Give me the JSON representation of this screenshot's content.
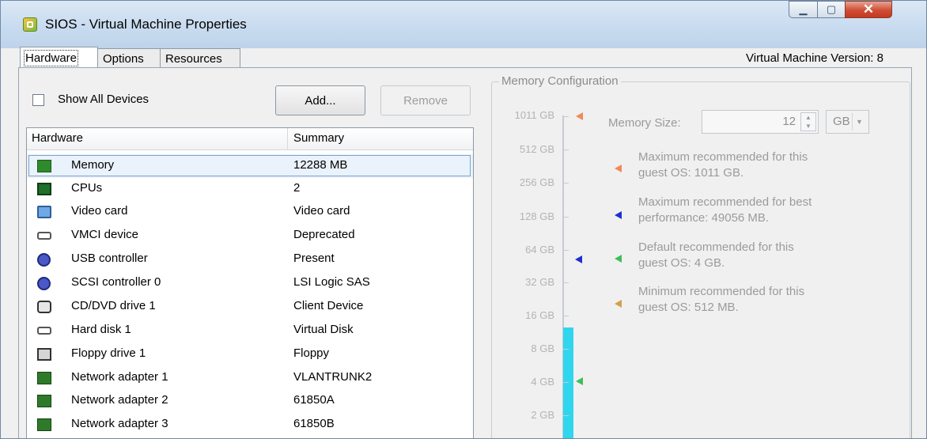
{
  "window": {
    "title": "SIOS - Virtual Machine Properties",
    "version_text": "Virtual Machine Version: 8"
  },
  "tabs": [
    "Hardware",
    "Options",
    "Resources"
  ],
  "toolbar": {
    "show_all_devices": "Show All Devices",
    "show_all_devices_checked": false,
    "add": "Add...",
    "remove": "Remove"
  },
  "hardware_table": {
    "columns": [
      "Hardware",
      "Summary"
    ],
    "rows": [
      {
        "name": "Memory",
        "summary": "12288 MB",
        "icon": "memory-icon",
        "selected": true
      },
      {
        "name": "CPUs",
        "summary": "2",
        "icon": "cpu-icon"
      },
      {
        "name": "Video card",
        "summary": "Video card",
        "icon": "monitor-icon"
      },
      {
        "name": "VMCI device",
        "summary": "Deprecated",
        "icon": "vmci-device-icon"
      },
      {
        "name": "USB controller",
        "summary": "Present",
        "icon": "usb-controller-icon"
      },
      {
        "name": "SCSI controller 0",
        "summary": "LSI Logic SAS",
        "icon": "scsi-controller-icon"
      },
      {
        "name": "CD/DVD drive 1",
        "summary": "Client Device",
        "icon": "cd-drive-icon"
      },
      {
        "name": "Hard disk 1",
        "summary": "Virtual Disk",
        "icon": "hard-disk-icon"
      },
      {
        "name": "Floppy drive 1",
        "summary": "Floppy",
        "icon": "floppy-icon"
      },
      {
        "name": "Network adapter 1",
        "summary": "VLANTRUNK2",
        "icon": "network-adapter-icon"
      },
      {
        "name": "Network adapter 2",
        "summary": "61850A",
        "icon": "network-adapter-icon"
      },
      {
        "name": "Network adapter 3",
        "summary": "61850B",
        "icon": "network-adapter-icon"
      }
    ]
  },
  "memory_config": {
    "legend": "Memory Configuration",
    "scale_labels": [
      "1011 GB",
      "512 GB",
      "256 GB",
      "128 GB",
      "64 GB",
      "32 GB",
      "16 GB",
      "8 GB",
      "4 GB",
      "2 GB"
    ],
    "memory_size_label": "Memory Size:",
    "memory_size_value": "12",
    "unit": "GB",
    "recommendations": [
      {
        "text_line1": "Maximum recommended for this",
        "text_line2": "guest OS: 1011 GB.",
        "color": "#f08a5a"
      },
      {
        "text_line1": "Maximum recommended for best",
        "text_line2": "performance: 49056 MB.",
        "color": "#1e2fd0"
      },
      {
        "text_line1": "Default recommended for this",
        "text_line2": "guest OS: 4 GB.",
        "color": "#3bbf59"
      },
      {
        "text_line1": "Minimum recommended for this",
        "text_line2": "guest OS: 512 MB.",
        "color": "#d4a04a"
      }
    ],
    "colors": {
      "fill": "#2fd6ee"
    }
  }
}
